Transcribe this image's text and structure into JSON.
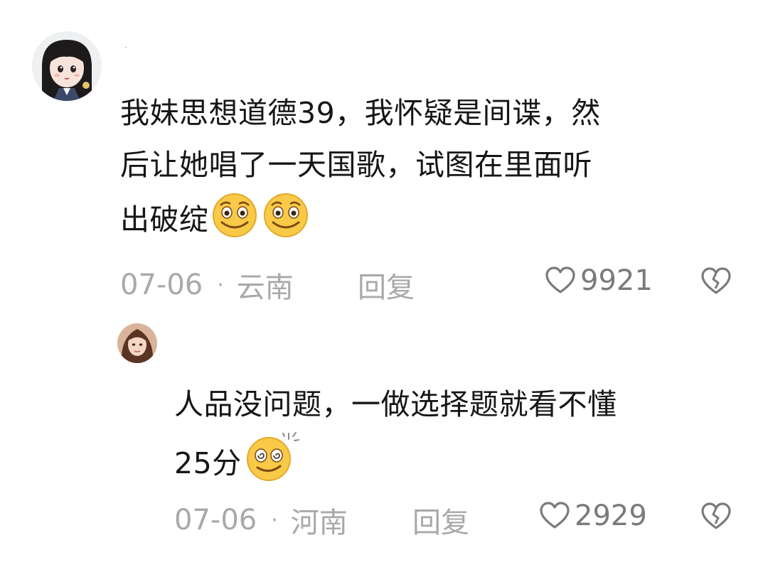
{
  "comments": [
    {
      "avatar_icon": "anime-girl-avatar-icon",
      "lines": [
        "我妹思想道德39，我怀疑是间谍，然",
        "后让她唱了一天国歌，试图在里面听",
        "出破绽"
      ],
      "trailing_emojis": [
        "smug-face-emoji",
        "smug-face-emoji"
      ],
      "date": "07-06",
      "separator": "·",
      "region": "云南",
      "reply_label": "回复",
      "likes": "9921",
      "dislike_icon": "broken-heart-icon"
    },
    {
      "avatar_icon": "woman-portrait-avatar-icon",
      "lines": [
        "人品没问题，一做选择题就看不懂",
        "25分"
      ],
      "trailing_emojis": [
        "dizzy-face-emoji"
      ],
      "date": "07-06",
      "separator": "·",
      "region": "河南",
      "reply_label": "回复",
      "likes": "2929",
      "dislike_icon": "broken-heart-icon"
    }
  ],
  "colors": {
    "text": "#161616",
    "meta": "#a9a9a9",
    "reply": "#8b8b8b",
    "like": "#7a7a7a",
    "emoji_yellow": "#f9c948"
  }
}
